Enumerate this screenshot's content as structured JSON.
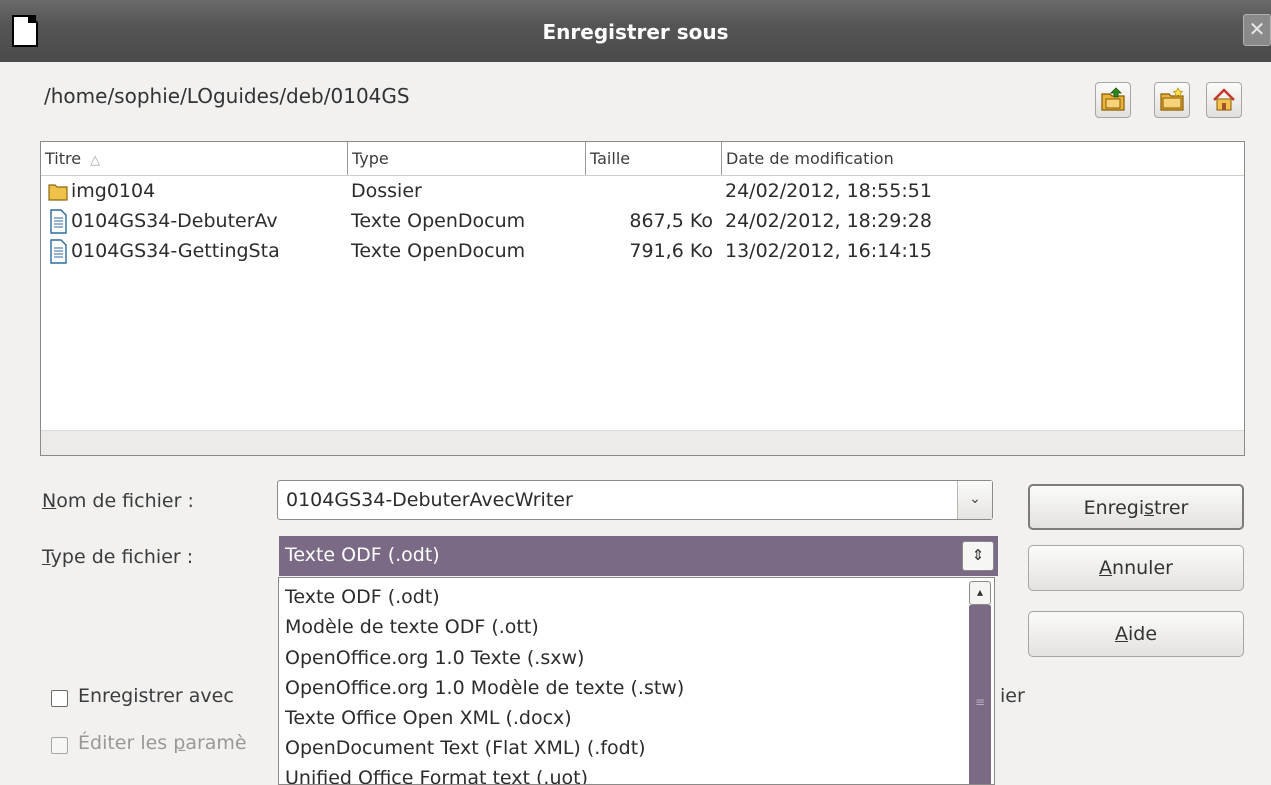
{
  "window": {
    "title": "Enregistrer sous",
    "close_glyph": "✕"
  },
  "path": "/home/sophie/LOguides/deb/0104GS",
  "toolbar": {
    "icons": [
      "folder-up-icon",
      "new-folder-icon",
      "home-icon"
    ]
  },
  "file_list": {
    "columns": [
      "Titre",
      "Type",
      "Taille",
      "Date de modification"
    ],
    "sort_indicator": "△",
    "rows": [
      {
        "icon": "folder-icon",
        "title": "img0104",
        "type": "Dossier",
        "size": "",
        "date": "24/02/2012, 18:55:51"
      },
      {
        "icon": "document-icon",
        "title": "0104GS34-DebuterAv",
        "type": "Texte OpenDocum",
        "size": "867,5 Ko",
        "date": "24/02/2012, 18:29:28"
      },
      {
        "icon": "document-icon",
        "title": "0104GS34-GettingSta",
        "type": "Texte OpenDocum",
        "size": "791,6 Ko",
        "date": "13/02/2012, 16:14:15"
      }
    ]
  },
  "filename": {
    "label_u": "N",
    "label_rest": "om de fichier :",
    "value": "0104GS34-DebuterAvecWriter"
  },
  "filetype": {
    "label_u": "T",
    "label_rest": "ype de fichier :",
    "selected": "Texte ODF (.odt)",
    "options": [
      "Texte ODF (.odt)",
      "Modèle de texte ODF (.ott)",
      "OpenOffice.org 1.0 Texte (.sxw)",
      "OpenOffice.org 1.0 Modèle de texte (.stw)",
      "Texte Office Open XML (.docx)",
      "OpenDocument Text (Flat XML) (.fodt)",
      "Unified Office Format text (.uot)"
    ]
  },
  "buttons": {
    "save_a": "Enregi",
    "save_u": "s",
    "save_b": "trer",
    "cancel_u": "A",
    "cancel_rest": "nnuler",
    "help_u": "A",
    "help_rest": "ide"
  },
  "options": {
    "password_visible": "Enregistrer avec",
    "password_suffix": "ier",
    "filter_a": "Éditer les ",
    "filter_u": "p",
    "filter_b": "aramè"
  }
}
